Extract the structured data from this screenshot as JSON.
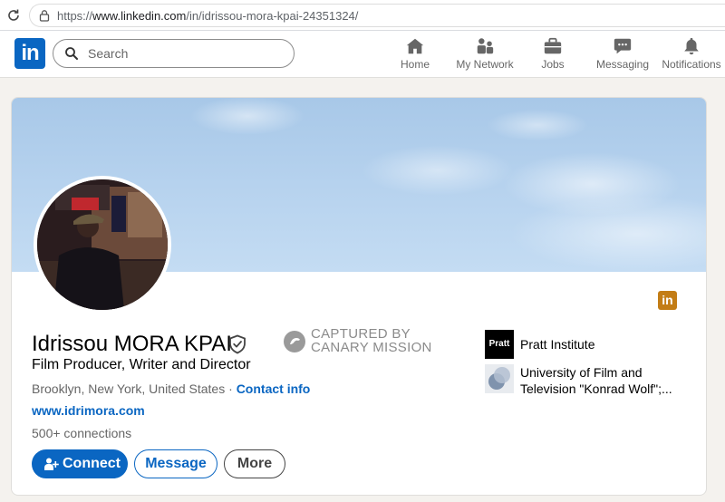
{
  "browser": {
    "url_prefix": "https://",
    "url_host": "www.linkedin.com",
    "url_path": "/in/idrissou-mora-kpai-24351324/"
  },
  "header": {
    "logo_text": "in",
    "search_placeholder": "Search",
    "nav": [
      {
        "label": "Home",
        "icon": "home-icon"
      },
      {
        "label": "My Network",
        "icon": "network-icon"
      },
      {
        "label": "Jobs",
        "icon": "briefcase-icon"
      },
      {
        "label": "Messaging",
        "icon": "messaging-icon"
      },
      {
        "label": "Notifications",
        "icon": "bell-icon"
      }
    ]
  },
  "profile": {
    "name": "Idrissou MORA KPAI",
    "headline": "Film Producer, Writer and Director",
    "location": "Brooklyn, New York, United States",
    "location_separator": " · ",
    "contact_label": "Contact info",
    "website": "www.idrimora.com",
    "connections": "500+ connections",
    "badge_text": "in"
  },
  "overlay": {
    "line1": "CAPTURED BY",
    "line2": "CANARY MISSION"
  },
  "actions": {
    "connect": "Connect",
    "message": "Message",
    "more": "More"
  },
  "experience": [
    {
      "logo": "Pratt",
      "label": "Pratt Institute"
    },
    {
      "label_line1": "University of Film and",
      "label_line2": "Television \"Konrad Wolf\";..."
    }
  ],
  "colors": {
    "brand": "#0a66c2",
    "badge": "#c37d16"
  }
}
